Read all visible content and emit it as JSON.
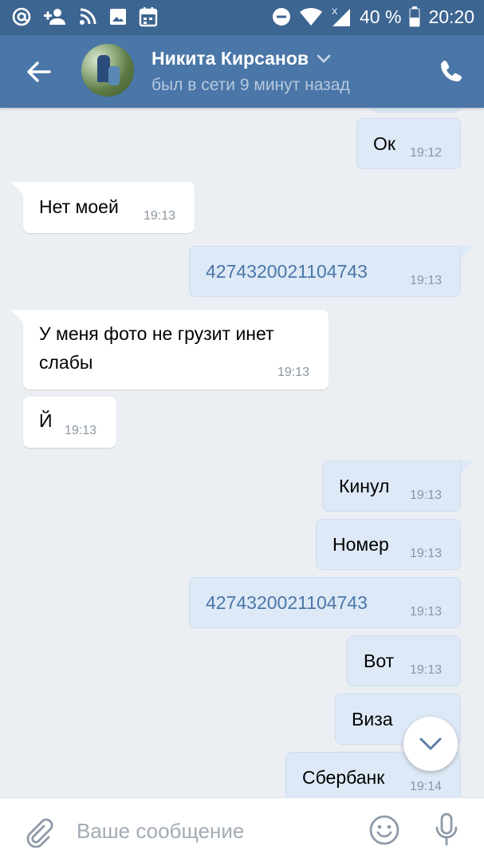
{
  "status_bar": {
    "battery": "40 %",
    "time": "20:20",
    "icons": [
      "at-icon",
      "add-friend-icon",
      "rss-icon",
      "image-icon",
      "calendar-icon",
      "do-not-disturb-icon",
      "wifi-icon",
      "signal-icon",
      "battery-icon"
    ]
  },
  "header": {
    "name": "Никита Кирсанов",
    "status": "был в сети 9 минут назад"
  },
  "messages": [
    {
      "dir": "out",
      "text": "Ок",
      "time": "19:12"
    },
    {
      "dir": "in",
      "text": "Нет моей",
      "time": "19:13"
    },
    {
      "dir": "out",
      "text": "4274320021104743",
      "time": "19:13",
      "link": true
    },
    {
      "dir": "in",
      "line1": "У меня фото не грузит инет",
      "line2": "слабы",
      "time": "19:13"
    },
    {
      "dir": "in",
      "text": "Й",
      "time": "19:13"
    },
    {
      "dir": "out",
      "text": "Кинул",
      "time": "19:13"
    },
    {
      "dir": "out",
      "text": "Номер",
      "time": "19:13"
    },
    {
      "dir": "out",
      "text": "4274320021104743",
      "time": "19:13",
      "link": true
    },
    {
      "dir": "out",
      "text": "Вот",
      "time": "19:13"
    },
    {
      "dir": "out",
      "text": "Виза",
      "time": ""
    },
    {
      "dir": "out",
      "text": "Сбербанк",
      "time": "19:14"
    }
  ],
  "input": {
    "placeholder": "Ваше сообщение",
    "value": ""
  },
  "colors": {
    "status_bar": "#3d6591",
    "header": "#4a76a8",
    "chat_bg": "#ebeef2",
    "out_bubble": "#dde9f6",
    "in_bubble": "#ffffff",
    "link": "#4a76a8"
  }
}
